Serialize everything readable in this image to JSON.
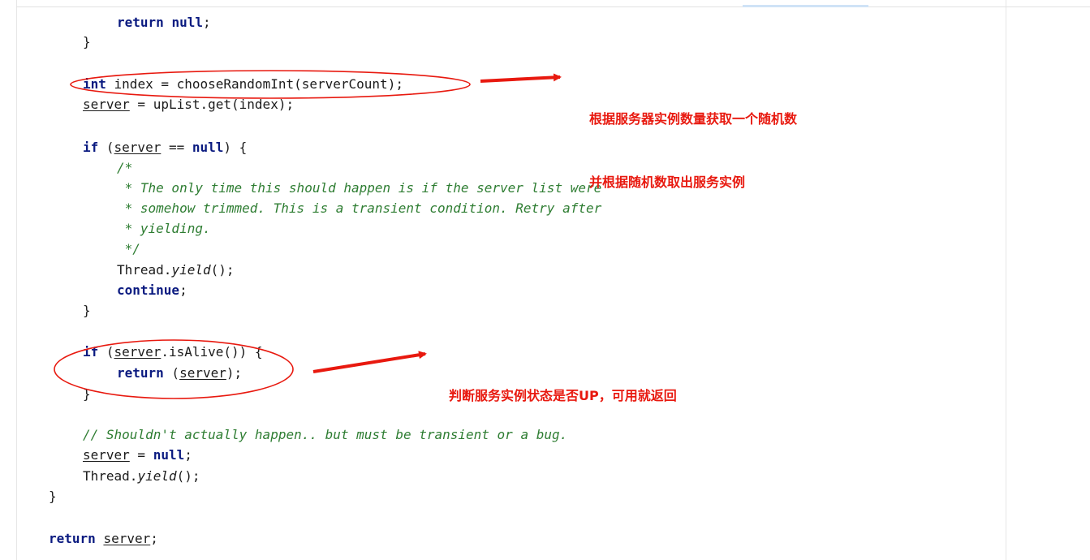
{
  "code": {
    "l1_kw": "return",
    "l1_null": "null",
    "l1_end": ";",
    "l2": "}",
    "l3_kw": "int",
    "l3_rest": " index = chooseRandomInt(serverCount);",
    "l4_var": "server",
    "l4_rest": " = upList.get(index);",
    "l5_kw": "if",
    "l5_open": " (",
    "l5_var": "server",
    "l5_mid": " == ",
    "l5_null": "null",
    "l5_close": ") {",
    "l6": "/*",
    "l7": " * The only time this should happen is if the server list were",
    "l8": " * somehow trimmed. This is a transient condition. Retry after",
    "l9": " * yielding.",
    "l10": " */",
    "l11_a": "Thread.",
    "l11_b": "yield",
    "l11_c": "();",
    "l12_kw": "continue",
    "l12_end": ";",
    "l13": "}",
    "l14_kw": "if",
    "l14_open": " (",
    "l14_var": "server",
    "l14_rest": ".isAlive()) {",
    "l15_kw": "return",
    "l15_open": " (",
    "l15_var": "server",
    "l15_close": ");",
    "l16": "}",
    "l17": "// Shouldn't actually happen.. but must be transient or a bug.",
    "l18_var": "server",
    "l18_mid": " = ",
    "l18_null": "null",
    "l18_end": ";",
    "l19_a": "Thread.",
    "l19_b": "yield",
    "l19_c": "();",
    "l20": "}",
    "l21_kw": "return",
    "l21_sp": " ",
    "l21_var": "server",
    "l21_end": ";"
  },
  "annotations": {
    "note1_line1": "根据服务器实例数量获取一个随机数",
    "note1_line2": "并根据随机数取出服务实例",
    "note2": "判断服务实例状态是否UP，可用就返回",
    "color": "#e8190f"
  }
}
